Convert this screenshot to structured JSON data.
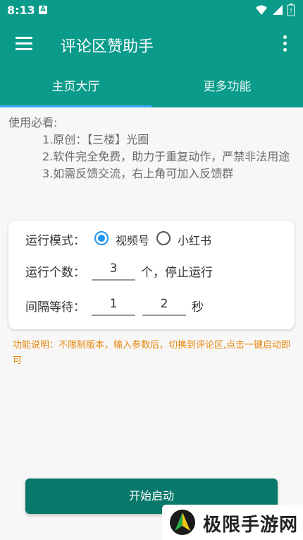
{
  "status_bar": {
    "time": "8:13",
    "notification_icon": "A"
  },
  "toolbar": {
    "title": "评论区赞助手"
  },
  "tabs": [
    {
      "label": "主页大厅",
      "selected": true
    },
    {
      "label": "更多功能",
      "selected": false
    }
  ],
  "notice": {
    "heading": "使用必看:",
    "items": [
      "1.原创：【三楼】光圈",
      "2.软件完全免费，助力于重复动作，严禁非法用途",
      "3.如需反馈交流，右上角可加入反馈群"
    ]
  },
  "settings": {
    "mode_label": "运行模式：",
    "mode_options": [
      {
        "label": "视频号",
        "checked": true
      },
      {
        "label": "小红书",
        "checked": false
      }
    ],
    "count_label": "运行个数：",
    "count_value": "3",
    "count_suffix": "个，停止运行",
    "interval_label": "间隔等待：",
    "interval_min": "1",
    "interval_max": "2",
    "interval_suffix": "秒"
  },
  "description": "功能说明：不限制版本，输入参数后，切换到评论区,点击一键启动即可",
  "start_button": "开始启动",
  "watermark": "极限手游网",
  "colors": {
    "primary": "#0a9b8a",
    "button": "#08786a",
    "accent": "#2196f3",
    "warning": "#e8870b"
  }
}
